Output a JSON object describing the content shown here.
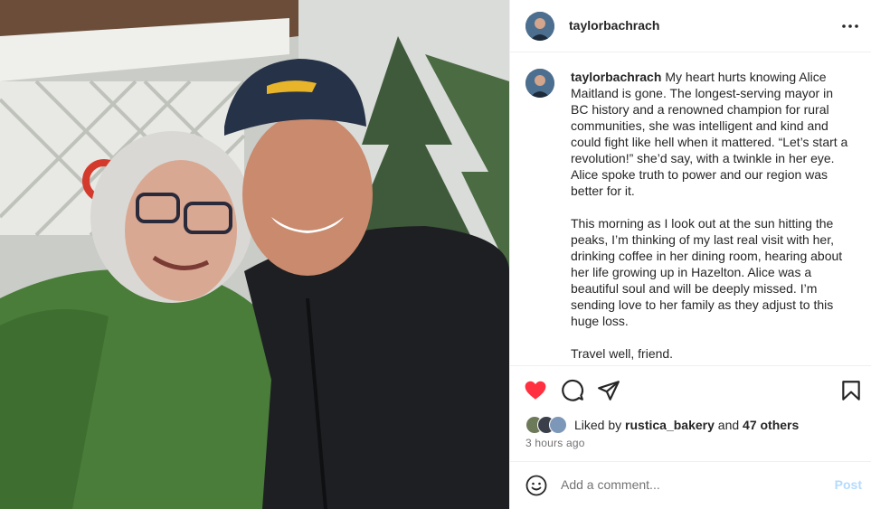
{
  "post": {
    "username": "taylorbachrach",
    "caption_paragraphs": [
      "My heart hurts knowing Alice Maitland is gone. The longest-serving mayor in BC history and a renowned champion for rural communities, she was intelligent and kind and could fight like hell when it mattered. “Let’s start a revolution!” she’d say, with a twinkle in her eye. Alice spoke truth to power and our region was better for it.",
      "This morning as I look out at the sun hitting the peaks, I’m thinking of my last real visit with her, drinking coffee in her dining room, hearing about her life growing up in Hazelton. Alice was a beautiful soul and will be deeply missed. I’m sending love to her family as they adjust to this huge loss.",
      "Travel well, friend."
    ],
    "liked_prefix": "Liked by",
    "liked_by_user": "rustica_bakery",
    "liked_and": "and",
    "liked_others": "47 others",
    "timestamp": "3 hours ago"
  },
  "icons": {
    "more": "more-horizontal-icon",
    "like": "heart-filled-icon",
    "comment": "comment-bubble-icon",
    "share": "paper-plane-icon",
    "save": "bookmark-icon",
    "emoji": "smiley-face-icon"
  },
  "comment_box": {
    "placeholder": "Add a comment...",
    "post_label": "Post"
  },
  "colors": {
    "heart": "#ff3040",
    "post_button_disabled": "#b3dbff",
    "secondary_text": "#737373",
    "sweater_green": "#4a7c3a",
    "jacket_black": "#1e1f22"
  }
}
